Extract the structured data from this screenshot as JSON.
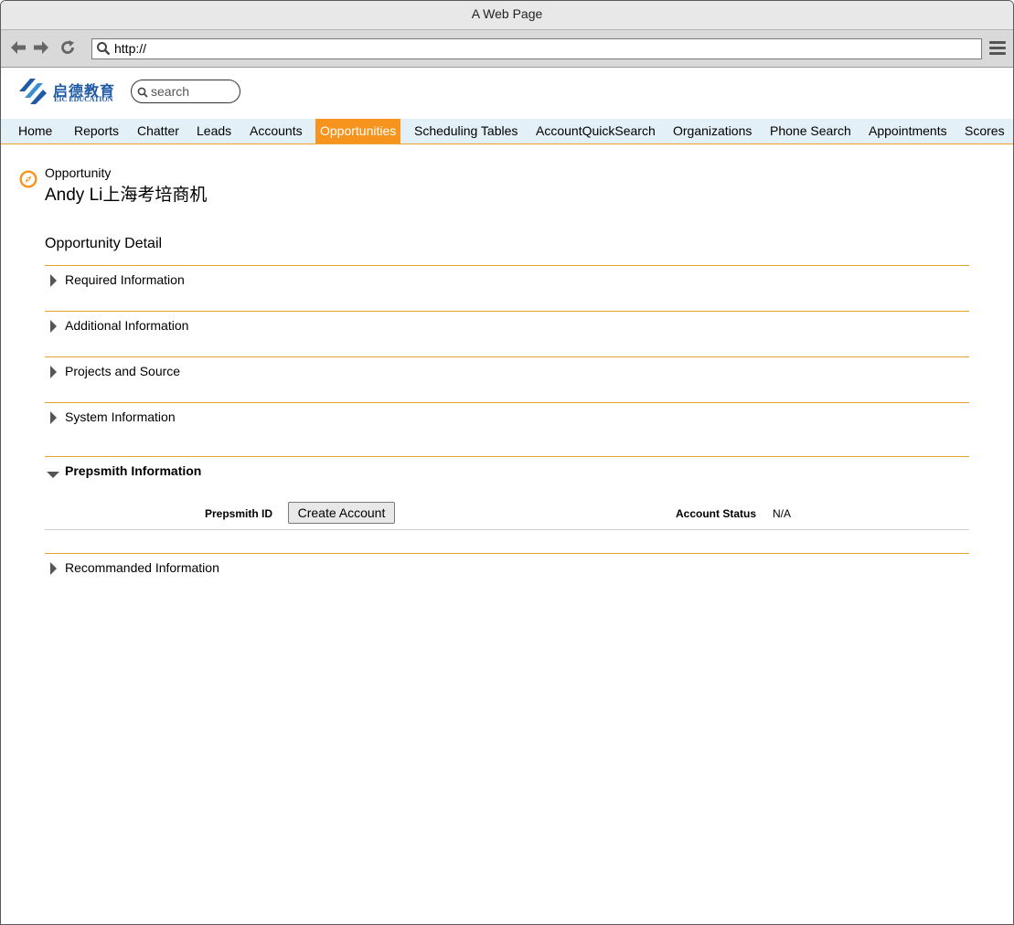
{
  "browser": {
    "title": "A Web Page",
    "url": "http://"
  },
  "header": {
    "logo_cn": "启德教育",
    "logo_en": "EIC EDUCATION",
    "search_placeholder": "search"
  },
  "nav": {
    "active_index": 5,
    "tabs": [
      {
        "label": "Home"
      },
      {
        "label": "Reports"
      },
      {
        "label": "Chatter"
      },
      {
        "label": "Leads"
      },
      {
        "label": "Accounts"
      },
      {
        "label": "Opportunities"
      },
      {
        "label": "Scheduling Tables"
      },
      {
        "label": "AccountQuickSearch"
      },
      {
        "label": "Organizations"
      },
      {
        "label": "Phone Search"
      },
      {
        "label": "Appointments"
      },
      {
        "label": "Scores"
      }
    ]
  },
  "record": {
    "type": "Opportunity",
    "name": "Andy Li上海考培商机"
  },
  "detail": {
    "title": "Opportunity Detail",
    "sections": [
      {
        "label": "Required Information",
        "expanded": false
      },
      {
        "label": "Additional Information",
        "expanded": false
      },
      {
        "label": "Projects and Source",
        "expanded": false
      },
      {
        "label": "System Information",
        "expanded": false
      },
      {
        "label": "Prepsmith Information",
        "expanded": true
      },
      {
        "label": "Recommanded Information",
        "expanded": false
      }
    ],
    "prepsmith": {
      "id_label": "Prepsmith ID",
      "create_button": "Create Account",
      "status_label": "Account Status",
      "status_value": "N/A"
    }
  },
  "colors": {
    "accent": "#f7941d",
    "nav_bg": "#e4f0f7",
    "brand_blue": "#1f5aa6"
  }
}
